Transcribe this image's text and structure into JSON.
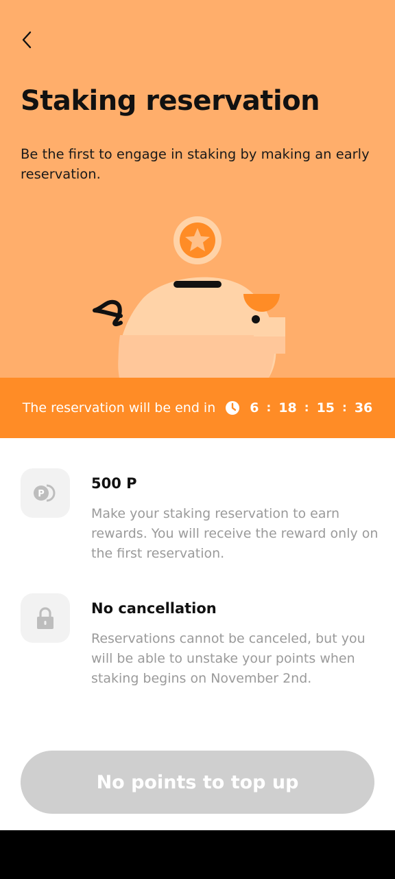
{
  "header": {
    "back_icon": "chevron-left-icon",
    "title": "Staking reservation",
    "subtitle": "Be the first to engage in staking by making an early reservation."
  },
  "timer": {
    "label": "The reservation will be end in",
    "icon": "clock-icon",
    "days": "6",
    "hours": "18",
    "minutes": "15",
    "seconds": "36",
    "separator": ":"
  },
  "features": [
    {
      "icon": "points-icon",
      "title": "500 P",
      "description": "Make your staking reservation to earn rewards. You will receive the reward only on the first reservation."
    },
    {
      "icon": "lock-icon",
      "title": "No cancellation",
      "description": "Reservations cannot be canceled, but you will be able to unstake your points when staking begins on November 2nd."
    }
  ],
  "cta": {
    "label": "No points to top up",
    "enabled": false
  },
  "colors": {
    "hero_bg": "#FFAE6B",
    "timer_bg": "#FF8C26",
    "accent": "#FF8C26",
    "button_disabled": "#CFCFCF"
  }
}
